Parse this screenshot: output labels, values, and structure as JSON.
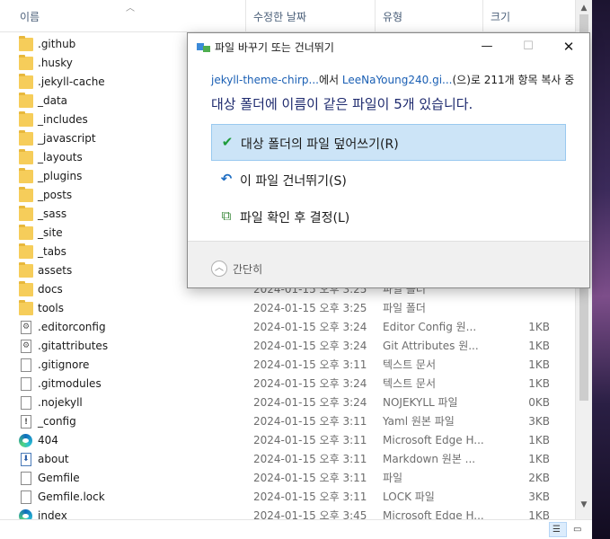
{
  "explorer": {
    "columns": {
      "name": "이름",
      "date": "수정한 날짜",
      "type": "유형",
      "size": "크기"
    },
    "rows": [
      {
        "icon": "folder-icon",
        "name": ".github",
        "date": "",
        "type": "",
        "size": ""
      },
      {
        "icon": "folder-icon",
        "name": ".husky",
        "date": "",
        "type": "",
        "size": ""
      },
      {
        "icon": "folder-icon",
        "name": ".jekyll-cache",
        "date": "",
        "type": "",
        "size": ""
      },
      {
        "icon": "folder-icon",
        "name": "_data",
        "date": "",
        "type": "",
        "size": ""
      },
      {
        "icon": "folder-icon",
        "name": "_includes",
        "date": "",
        "type": "",
        "size": ""
      },
      {
        "icon": "folder-icon",
        "name": "_javascript",
        "date": "",
        "type": "",
        "size": ""
      },
      {
        "icon": "folder-icon",
        "name": "_layouts",
        "date": "",
        "type": "",
        "size": ""
      },
      {
        "icon": "folder-icon",
        "name": "_plugins",
        "date": "",
        "type": "",
        "size": ""
      },
      {
        "icon": "folder-icon",
        "name": "_posts",
        "date": "",
        "type": "",
        "size": ""
      },
      {
        "icon": "folder-icon",
        "name": "_sass",
        "date": "",
        "type": "",
        "size": ""
      },
      {
        "icon": "folder-icon",
        "name": "_site",
        "date": "",
        "type": "",
        "size": ""
      },
      {
        "icon": "folder-icon",
        "name": "_tabs",
        "date": "",
        "type": "",
        "size": ""
      },
      {
        "icon": "folder-icon",
        "name": "assets",
        "date": "",
        "type": "",
        "size": ""
      },
      {
        "icon": "folder-icon",
        "name": "docs",
        "date": "2024-01-15 오후 3:25",
        "type": "파일 폴더",
        "size": ""
      },
      {
        "icon": "folder-icon",
        "name": "tools",
        "date": "2024-01-15 오후 3:25",
        "type": "파일 폴더",
        "size": ""
      },
      {
        "icon": "config-file-icon",
        "name": ".editorconfig",
        "date": "2024-01-15 오후 3:24",
        "type": "Editor Config 원...",
        "size": "1KB"
      },
      {
        "icon": "config-file-icon",
        "name": ".gitattributes",
        "date": "2024-01-15 오후 3:24",
        "type": "Git Attributes 원...",
        "size": "1KB"
      },
      {
        "icon": "text-file-icon",
        "name": ".gitignore",
        "date": "2024-01-15 오후 3:11",
        "type": "텍스트 문서",
        "size": "1KB"
      },
      {
        "icon": "text-file-icon",
        "name": ".gitmodules",
        "date": "2024-01-15 오후 3:24",
        "type": "텍스트 문서",
        "size": "1KB"
      },
      {
        "icon": "blank-file-icon",
        "name": ".nojekyll",
        "date": "2024-01-15 오후 3:24",
        "type": "NOJEKYLL 파일",
        "size": "0KB"
      },
      {
        "icon": "yaml-file-icon",
        "name": "_config",
        "date": "2024-01-15 오후 3:11",
        "type": "Yaml 원본 파일",
        "size": "3KB"
      },
      {
        "icon": "edge-html-icon",
        "name": "404",
        "date": "2024-01-15 오후 3:11",
        "type": "Microsoft Edge H...",
        "size": "1KB"
      },
      {
        "icon": "markdown-file-icon",
        "name": "about",
        "date": "2024-01-15 오후 3:11",
        "type": "Markdown 원본 ...",
        "size": "1KB"
      },
      {
        "icon": "blank-file-icon",
        "name": "Gemfile",
        "date": "2024-01-15 오후 3:11",
        "type": "파일",
        "size": "2KB"
      },
      {
        "icon": "blank-file-icon",
        "name": "Gemfile.lock",
        "date": "2024-01-15 오후 3:11",
        "type": "LOCK 파일",
        "size": "3KB"
      },
      {
        "icon": "edge-html-icon",
        "name": "index",
        "date": "2024-01-15 오후 3:45",
        "type": "Microsoft Edge H...",
        "size": "1KB"
      }
    ]
  },
  "dialog": {
    "title": "파일 바꾸기 또는 건너뛰기",
    "minimize": "—",
    "maximize": "☐",
    "close": "✕",
    "copy_line": {
      "source": "jekyll-theme-chirp...",
      "from_text": "에서 ",
      "dest": "LeeNaYoung240.gi...",
      "rest": "(으)로 211개 항목 복사 중"
    },
    "headline": "대상 폴더에 이름이 같은 파일이 5개 있습니다.",
    "options": [
      {
        "label": "대상 폴더의 파일 덮어쓰기(R)",
        "icon": "✔",
        "selected": true
      },
      {
        "label": "이 파일 건너뛰기(S)",
        "icon": "↶",
        "selected": false
      },
      {
        "label": "파일 확인 후 결정(L)",
        "icon": "⧉",
        "selected": false
      }
    ],
    "collapse_label": "간단히",
    "collapse_icon": "︿"
  },
  "scrollbar": {
    "up": "▲",
    "down": "▼"
  },
  "statusbar": {
    "details_view_icon": "☰",
    "tiles_view_icon": "▭"
  }
}
